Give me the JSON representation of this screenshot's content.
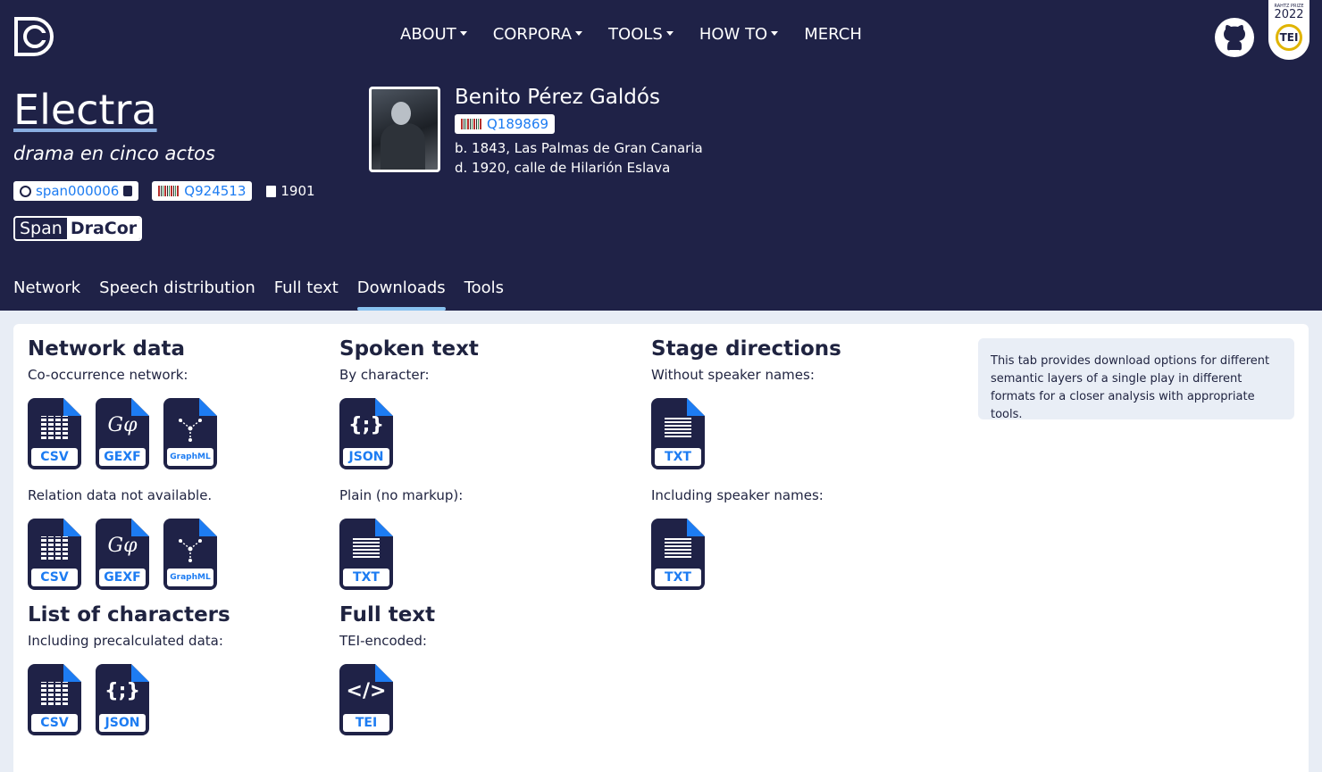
{
  "nav": {
    "items": [
      {
        "label": "ABOUT",
        "dropdown": true
      },
      {
        "label": "CORPORA",
        "dropdown": true
      },
      {
        "label": "TOOLS",
        "dropdown": true
      },
      {
        "label": "HOW TO",
        "dropdown": true
      },
      {
        "label": "MERCH",
        "dropdown": false
      }
    ],
    "prize_top": "RAHTZ PRIZE",
    "prize_year": "2022",
    "prize_badge": "TEI"
  },
  "play": {
    "title": "Electra",
    "subtitle": "drama en cinco actos",
    "id": "span000006",
    "wikidata": "Q924513",
    "year": "1901",
    "corpus_prefix": "Span",
    "corpus_suffix": "DraCor"
  },
  "author": {
    "name": "Benito Pérez Galdós",
    "wikidata": "Q189869",
    "born": "b. 1843, Las Palmas de Gran Canaria",
    "died": "d. 1920, calle de Hilarión Eslava"
  },
  "tabs": [
    {
      "label": "Network",
      "active": false
    },
    {
      "label": "Speech distribution",
      "active": false
    },
    {
      "label": "Full text",
      "active": false
    },
    {
      "label": "Downloads",
      "active": true
    },
    {
      "label": "Tools",
      "active": false
    }
  ],
  "downloads": {
    "network": {
      "heading": "Network data",
      "cooc_label": "Co-occurrence network:",
      "relation_label": "Relation data not available.",
      "formats": [
        "CSV",
        "GEXF",
        "GraphML"
      ]
    },
    "characters": {
      "heading": "List of characters",
      "label": "Including precalculated data:",
      "formats": [
        "CSV",
        "JSON"
      ]
    },
    "spoken": {
      "heading": "Spoken text",
      "by_char_label": "By character:",
      "plain_label": "Plain (no markup):",
      "by_char_format": "JSON",
      "plain_format": "TXT"
    },
    "fulltext": {
      "heading": "Full text",
      "label": "TEI-encoded:",
      "format": "TEI"
    },
    "stage": {
      "heading": "Stage directions",
      "without_label": "Without speaker names:",
      "with_label": "Including speaker names:",
      "format": "TXT"
    },
    "info": "This tab provides download options for different semantic layers of a single play in different formats for a closer analysis with appropriate tools."
  }
}
